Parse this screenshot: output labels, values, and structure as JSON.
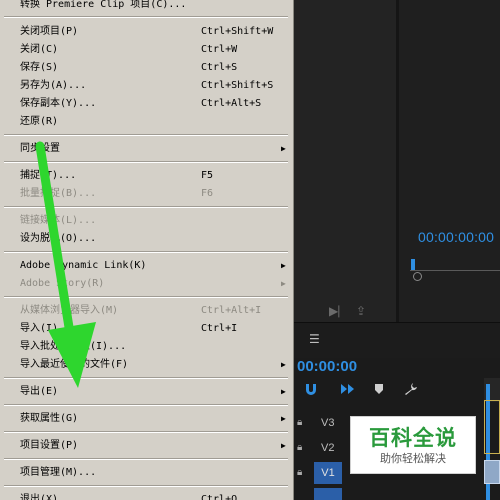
{
  "menu": {
    "items": [
      {
        "label": "转换 Premiere Clip 项目(C)...",
        "shortcut": "",
        "submenu": false,
        "disabled": false
      },
      {
        "label": "关闭项目(P)",
        "shortcut": "Ctrl+Shift+W",
        "submenu": false,
        "disabled": false
      },
      {
        "label": "关闭(C)",
        "shortcut": "Ctrl+W",
        "submenu": false,
        "disabled": false
      },
      {
        "label": "保存(S)",
        "shortcut": "Ctrl+S",
        "submenu": false,
        "disabled": false
      },
      {
        "label": "另存为(A)...",
        "shortcut": "Ctrl+Shift+S",
        "submenu": false,
        "disabled": false
      },
      {
        "label": "保存副本(Y)...",
        "shortcut": "Ctrl+Alt+S",
        "submenu": false,
        "disabled": false
      },
      {
        "label": "还原(R)",
        "shortcut": "",
        "submenu": false,
        "disabled": false
      },
      {
        "label": "同步设置",
        "shortcut": "",
        "submenu": true,
        "disabled": false
      },
      {
        "label": "捕捉(T)...",
        "shortcut": "F5",
        "submenu": false,
        "disabled": false
      },
      {
        "label": "批量捕捉(B)...",
        "shortcut": "F6",
        "submenu": false,
        "disabled": true
      },
      {
        "label": "链接媒体(L)...",
        "shortcut": "",
        "submenu": false,
        "disabled": true
      },
      {
        "label": "设为脱机(O)...",
        "shortcut": "",
        "submenu": false,
        "disabled": false
      },
      {
        "label": "Adobe Dynamic Link(K)",
        "shortcut": "",
        "submenu": true,
        "disabled": false
      },
      {
        "label": "Adobe Story(R)",
        "shortcut": "",
        "submenu": true,
        "disabled": true
      },
      {
        "label": "从媒体浏览器导入(M)",
        "shortcut": "Ctrl+Alt+I",
        "submenu": false,
        "disabled": true
      },
      {
        "label": "导入(I)...",
        "shortcut": "Ctrl+I",
        "submenu": false,
        "disabled": false
      },
      {
        "label": "导入批处理列表(I)...",
        "shortcut": "",
        "submenu": false,
        "disabled": false
      },
      {
        "label": "导入最近使用的文件(F)",
        "shortcut": "",
        "submenu": true,
        "disabled": false
      },
      {
        "label": "导出(E)",
        "shortcut": "",
        "submenu": true,
        "disabled": false
      },
      {
        "label": "获取属性(G)",
        "shortcut": "",
        "submenu": true,
        "disabled": false
      },
      {
        "label": "项目设置(P)",
        "shortcut": "",
        "submenu": true,
        "disabled": false
      },
      {
        "label": "项目管理(M)...",
        "shortcut": "",
        "submenu": false,
        "disabled": false
      },
      {
        "label": "退出(X)",
        "shortcut": "Ctrl+Q",
        "submenu": false,
        "disabled": false
      }
    ],
    "submenu_arrow": "▶"
  },
  "monitor": {
    "timecode": "00:00:00:00"
  },
  "timeline": {
    "menu_icon": "☰",
    "timecode": "00:00:00",
    "tracks": [
      {
        "label": "V3"
      },
      {
        "label": "V2"
      },
      {
        "label": "V1"
      }
    ]
  },
  "watermark": {
    "title": "百科全说",
    "subtitle": "助你轻松解决"
  },
  "colors": {
    "accent_blue": "#2f8fe2",
    "menu_bg": "#d4d0c8",
    "annotation_arrow": "#2ed62e",
    "watermark_green": "#2a9a3c"
  },
  "icons": [
    "lock-icon",
    "magnet-icon",
    "marker-icon",
    "wrench-icon",
    "linked-selection-icon",
    "chevron-right-icon"
  ]
}
